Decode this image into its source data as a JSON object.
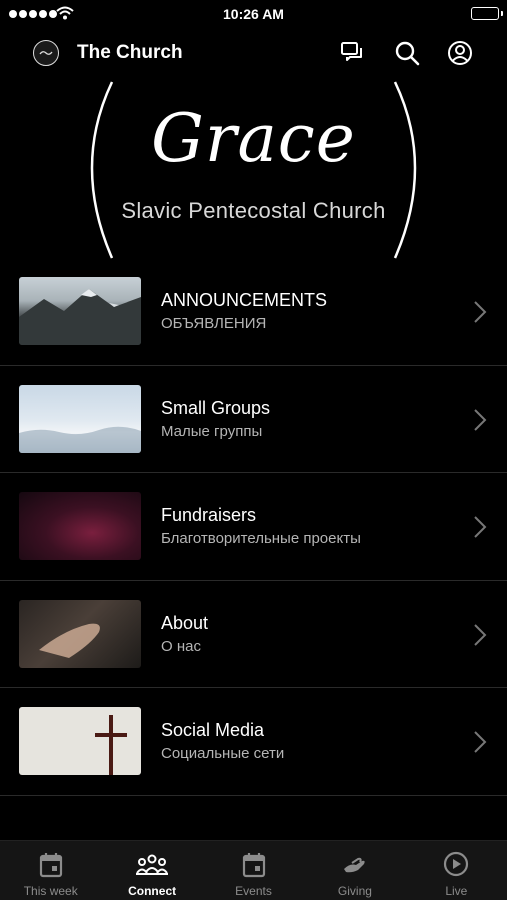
{
  "status_bar": {
    "time": "10:26 AM"
  },
  "header": {
    "title": "The Church"
  },
  "hero": {
    "script_text": "Grace",
    "subtitle": "Slavic Pentecostal Church"
  },
  "items": [
    {
      "title": "ANNOUNCEMENTS",
      "subtitle": "ОБЪЯВЛЕНИЯ"
    },
    {
      "title": "Small Groups",
      "subtitle": "Малые группы"
    },
    {
      "title": "Fundraisers",
      "subtitle": "Благотворительные проекты"
    },
    {
      "title": "About",
      "subtitle": "О нас"
    },
    {
      "title": "Social Media",
      "subtitle": "Социальные сети"
    }
  ],
  "tabs": [
    {
      "label": "This week",
      "icon": "calendar-icon",
      "active": false
    },
    {
      "label": "Connect",
      "icon": "people-icon",
      "active": true
    },
    {
      "label": "Events",
      "icon": "calendar-icon",
      "active": false
    },
    {
      "label": "Giving",
      "icon": "giving-hand-icon",
      "active": false
    },
    {
      "label": "Live",
      "icon": "play-circle-icon",
      "active": false
    }
  ],
  "colors": {
    "background": "#000000",
    "text": "#ffffff",
    "muted": "#b5b5b5",
    "tab_bar": "#151515"
  }
}
